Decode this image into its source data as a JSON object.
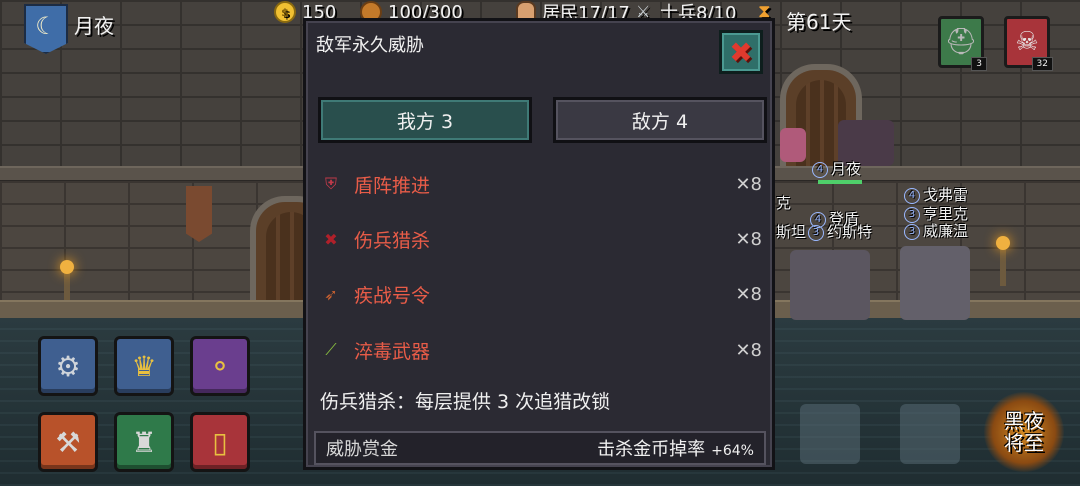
{
  "hud": {
    "night_name": "月夜",
    "gold": "150",
    "wood": "100/300",
    "population": "居民17/17",
    "soldiers": "士兵8/10",
    "day": "第61天",
    "right_buttons": [
      {
        "icon": "helmet-icon",
        "count": "3"
      },
      {
        "icon": "skull-icon",
        "count": "32"
      }
    ]
  },
  "scene_units": [
    {
      "number": "4",
      "name": "月夜"
    },
    {
      "number": "4",
      "name": "戈弗雷"
    },
    {
      "number": "3",
      "name": "亨里克"
    },
    {
      "number": "3",
      "name": "威廉温"
    },
    {
      "number": "4",
      "name": "登盾"
    },
    {
      "number": "3",
      "name": "约斯特"
    },
    {
      "number": "",
      "name": "克"
    },
    {
      "number": "",
      "name": "斯坦"
    }
  ],
  "action_buttons": [
    {
      "name": "settings",
      "icon": "gear-icon",
      "glyph": "⚙"
    },
    {
      "name": "crown",
      "icon": "crown-icon",
      "glyph": "♛"
    },
    {
      "name": "skill-tree",
      "icon": "nodes-icon",
      "glyph": "⚬"
    },
    {
      "name": "forge",
      "icon": "anvil-icon",
      "glyph": "⚒"
    },
    {
      "name": "tower",
      "icon": "tower-icon",
      "glyph": "♜"
    },
    {
      "name": "cards",
      "icon": "cards-icon",
      "glyph": "▯"
    }
  ],
  "night_badge": {
    "line1": "黑夜",
    "line2": "将至"
  },
  "modal": {
    "title": "敌军永久威胁",
    "tabs": [
      {
        "label": "我方 3",
        "active": true
      },
      {
        "label": "敌方 4",
        "active": false
      }
    ],
    "threats": [
      {
        "icon": "shield-advance-icon",
        "glyph": "⛨",
        "name": "盾阵推进",
        "count": "✕8",
        "color": "#c23a4a"
      },
      {
        "icon": "blood-hunt-icon",
        "glyph": "✖",
        "name": "伤兵猎杀",
        "count": "✕8",
        "color": "#b0202a"
      },
      {
        "icon": "war-horn-icon",
        "glyph": "➶",
        "name": "疾战号令",
        "count": "✕8",
        "color": "#c86030"
      },
      {
        "icon": "poison-weapon-icon",
        "glyph": "⟋",
        "name": "淬毒武器",
        "count": "✕8",
        "color": "#8ac040"
      }
    ],
    "description": "伤兵猎杀：每层提供 3 次追猎改锁",
    "bounty": {
      "label": "威胁赏金",
      "stat": "击杀金币掉率",
      "value": "+64%"
    }
  }
}
